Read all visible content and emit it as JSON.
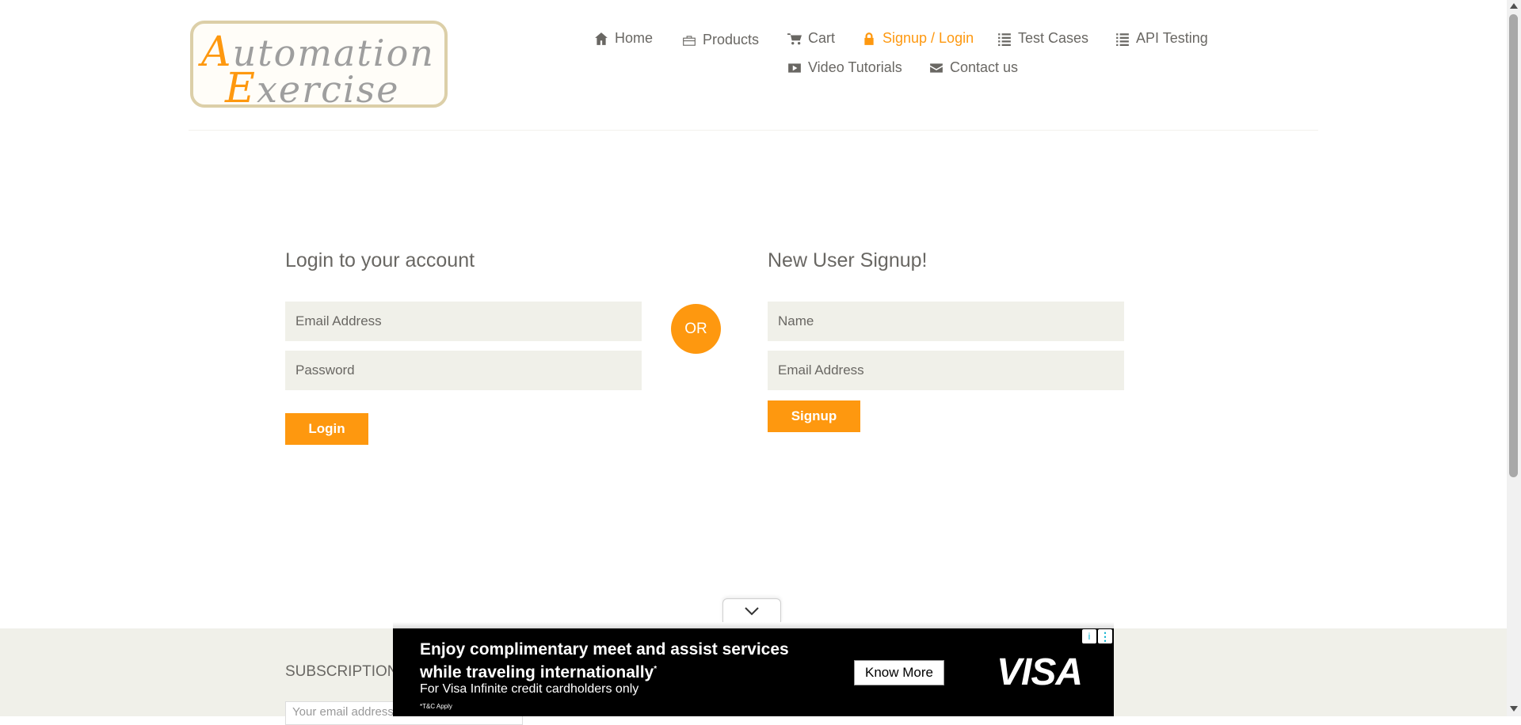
{
  "logo": {
    "line1_cap": "A",
    "line1_rest": "utomation",
    "line2_cap": "E",
    "line2_rest": "xercise"
  },
  "nav": [
    {
      "label": "Home",
      "icon": "home-icon"
    },
    {
      "label": "Products",
      "icon": "briefcase-icon"
    },
    {
      "label": "Cart",
      "icon": "cart-icon"
    },
    {
      "label": "Signup / Login",
      "icon": "lock-icon",
      "active": true
    },
    {
      "label": "Test Cases",
      "icon": "list-icon"
    },
    {
      "label": "API Testing",
      "icon": "list-icon"
    },
    {
      "label": "Video Tutorials",
      "icon": "youtube-icon"
    },
    {
      "label": "Contact us",
      "icon": "envelope-icon"
    }
  ],
  "login": {
    "title": "Login to your account",
    "email_placeholder": "Email Address",
    "password_placeholder": "Password",
    "button": "Login"
  },
  "or_label": "OR",
  "signup": {
    "title": "New User Signup!",
    "name_placeholder": "Name",
    "email_placeholder": "Email Address",
    "button": "Signup"
  },
  "footer": {
    "subscription_title": "SUBSCRIPTION",
    "subscription_placeholder": "Your email address"
  },
  "ad": {
    "headline": "Enjoy complimentary meet and assist services while traveling internationally",
    "headline_mark": "*",
    "sub": "For Visa Infinite credit cardholders only",
    "fine": "*T&C Apply",
    "cta": "Know More",
    "brand": "VISA",
    "info": "i",
    "more": "⋮"
  },
  "colors": {
    "accent": "#fe980f",
    "text": "#696763",
    "field_bg": "#f0f0e9"
  }
}
